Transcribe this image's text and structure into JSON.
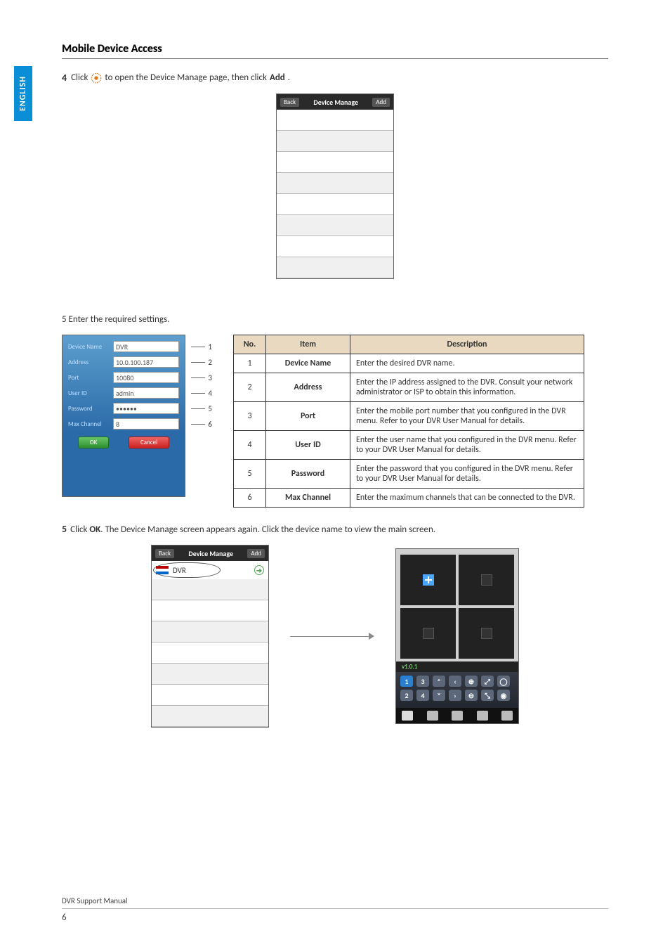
{
  "side_tab": "ENGLISH",
  "section_title": "Mobile Device Access",
  "step4": {
    "num": "4",
    "pre": "Click",
    "post_a": "to open the Device Manage page, then click ",
    "bold": "Add",
    "post_b": "."
  },
  "phone1": {
    "back": "Back",
    "title": "Device Manage",
    "add": "Add"
  },
  "step_settings_line": "5 Enter the required settings.",
  "form": {
    "labels": {
      "name": "Device Name",
      "address": "Address",
      "port": "Port",
      "user": "User ID",
      "password": "Password",
      "max": "Max Channel"
    },
    "values": {
      "name": "DVR",
      "address": "10.0.100.187",
      "port": "10080",
      "user": "admin",
      "password": "••••••",
      "max": "8"
    },
    "ok": "OK",
    "cancel": "Cancel"
  },
  "callouts": [
    "1",
    "2",
    "3",
    "4",
    "5",
    "6"
  ],
  "table": {
    "head": {
      "no": "No.",
      "item": "Item",
      "desc": "Description"
    },
    "rows": [
      {
        "no": "1",
        "item": "Device Name",
        "desc": "Enter the desired DVR name."
      },
      {
        "no": "2",
        "item": "Address",
        "desc": "Enter the IP address assigned to the DVR. Consult your network administrator or ISP to obtain this information."
      },
      {
        "no": "3",
        "item": "Port",
        "desc": "Enter the mobile port number that you configured in the DVR menu. Refer to your DVR User Manual for details."
      },
      {
        "no": "4",
        "item": "User ID",
        "desc": "Enter the user name that you configured in the DVR menu. Refer to your DVR User Manual for details."
      },
      {
        "no": "5",
        "item": "Password",
        "desc": "Enter the password that you configured in the DVR menu. Refer to your DVR User Manual for details."
      },
      {
        "no": "6",
        "item": "Max Channel",
        "desc": "Enter the maximum channels that can be connected to the DVR."
      }
    ]
  },
  "step5": {
    "num": "5",
    "pre": "Click ",
    "bold": "OK",
    "post": ". The Device Manage screen appears again. Click the device name to view the main screen."
  },
  "phone2": {
    "back": "Back",
    "title": "Device Manage",
    "add": "Add",
    "entry": "DVR"
  },
  "live": {
    "version": "v1.0.1",
    "keys_row1": [
      "1",
      "3",
      "˄",
      "‹",
      "⊕",
      "⤢",
      "◯"
    ],
    "keys_row2": [
      "2",
      "4",
      "˅",
      "›",
      "⊖",
      "⤡",
      "◉"
    ]
  },
  "footer": {
    "title": "DVR Support Manual",
    "page": "6"
  }
}
